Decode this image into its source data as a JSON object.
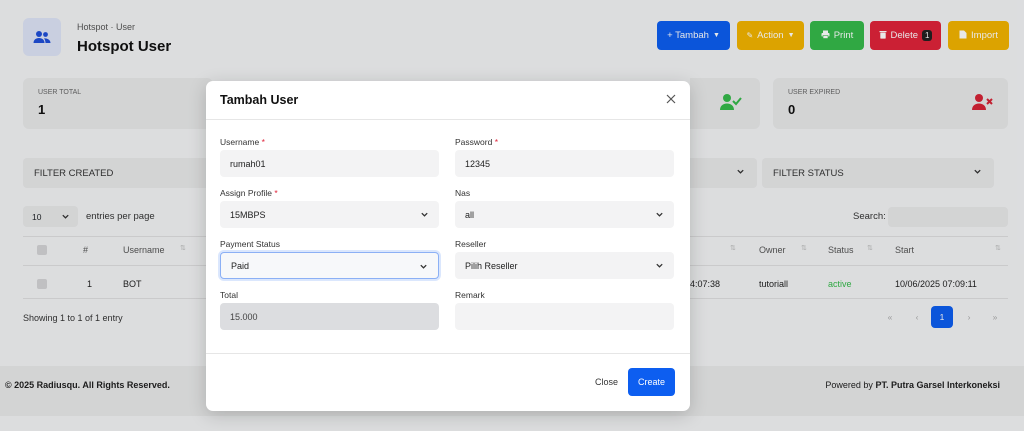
{
  "header": {
    "breadcrumb": "Hotspot · User",
    "title": "Hotspot User",
    "buttons": {
      "tambah": "+ Tambah",
      "action": "Action",
      "print": "Print",
      "delete": "Delete",
      "delete_count": "1",
      "import": "Import"
    }
  },
  "stats": {
    "user_total": {
      "label": "USER TOTAL",
      "value": "1"
    },
    "user_expired": {
      "label": "USER EXPIRED",
      "value": "0"
    }
  },
  "filters": {
    "created": "FILTER CREATED",
    "status": "FILTER STATUS"
  },
  "table": {
    "length_value": "10",
    "entries_label": "entries per page",
    "search_label": "Search:",
    "columns": {
      "num": "#",
      "username": "Username",
      "owner": "Owner",
      "status": "Status",
      "start": "Start"
    },
    "row": {
      "num": "1",
      "username": "BOT",
      "time_fragment": "4:07:38",
      "owner": "tutoriall",
      "status": "active",
      "start": "10/06/2025 07:09:11"
    },
    "info": "Showing 1 to 1 of 1 entry",
    "pagination": {
      "first": "«",
      "prev": "‹",
      "page": "1",
      "next": "›",
      "last": "»"
    }
  },
  "footer": {
    "copyright": "© 2025 Radiusqu. All Rights Reserved.",
    "powered_prefix": "Powered by",
    "powered_company": "PT. Putra Garsel Interkoneksi"
  },
  "modal": {
    "title": "Tambah User",
    "fields": {
      "username": {
        "label": "Username",
        "value": "rumah01"
      },
      "password": {
        "label": "Password",
        "value": "12345"
      },
      "assign_profile": {
        "label": "Assign Profile",
        "value": "15MBPS"
      },
      "nas": {
        "label": "Nas",
        "value": "all"
      },
      "payment_status": {
        "label": "Payment Status",
        "value": "Paid"
      },
      "reseller": {
        "label": "Reseller",
        "value": "Pilih Reseller"
      },
      "total": {
        "label": "Total",
        "value": "15.000"
      },
      "remark": {
        "label": "Remark",
        "value": ""
      }
    },
    "required_mark": "*",
    "close_label": "Close",
    "create_label": "Create"
  },
  "colors": {
    "primary": "#0d5ef0",
    "warning": "#f2b400",
    "success": "#35b94a",
    "danger": "#e0243a"
  }
}
